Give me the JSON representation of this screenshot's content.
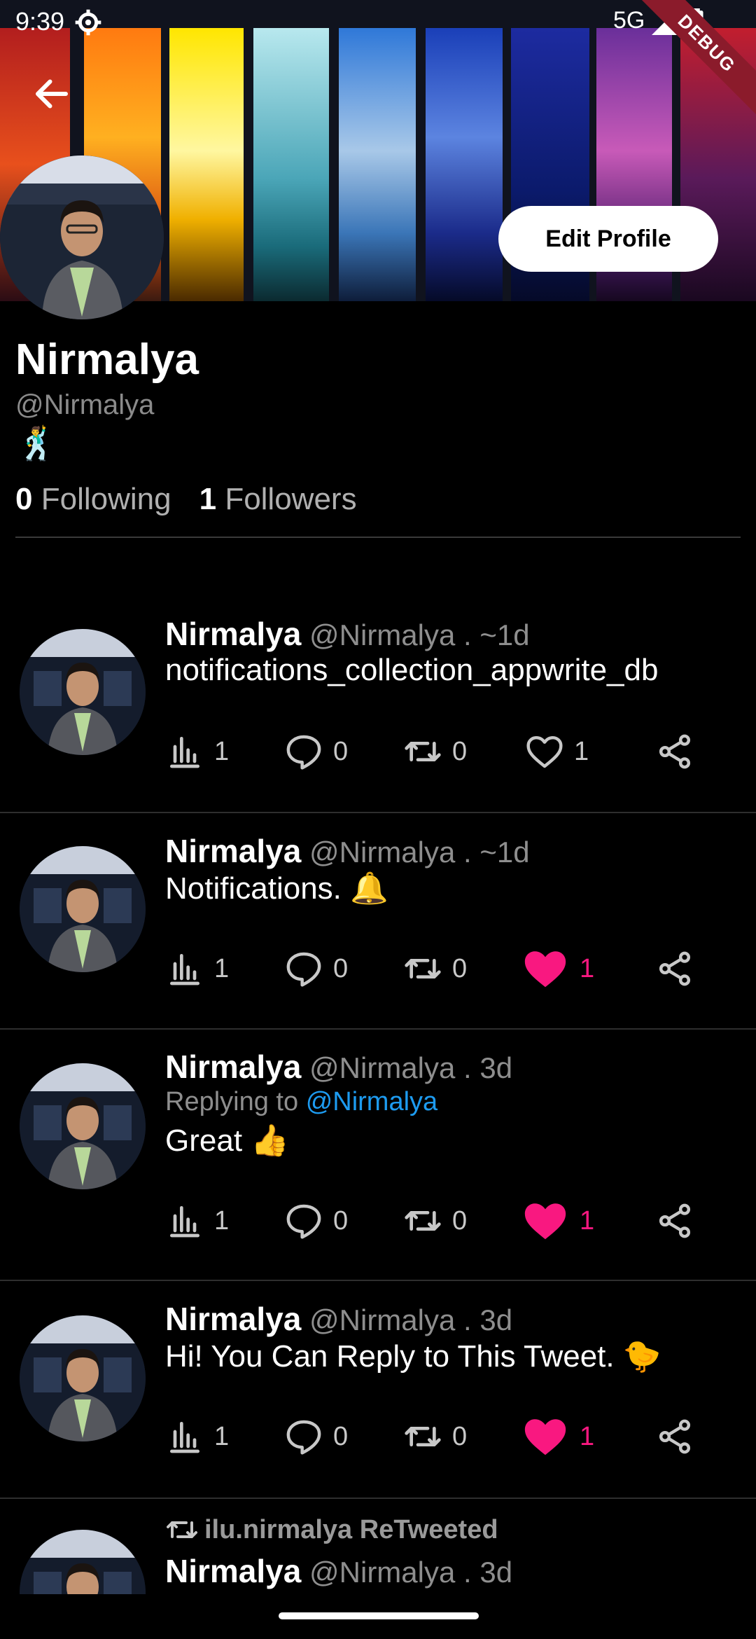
{
  "status": {
    "time": "9:39",
    "network": "5G",
    "debug_label": "DEBUG"
  },
  "profile": {
    "edit_button": "Edit Profile",
    "name": "Nirmalya",
    "handle": "@Nirmalya",
    "bio_emoji": "🕺",
    "following_count": "0",
    "following_label": "Following",
    "followers_count": "1",
    "followers_label": "Followers"
  },
  "tweets": [
    {
      "name": "Nirmalya",
      "meta": "@Nirmalya . ~1d",
      "text": "notifications_collection_appwrite_db",
      "views": "1",
      "comments": "0",
      "retweets": "0",
      "likes": "1",
      "liked": false
    },
    {
      "name": "Nirmalya",
      "meta": "@Nirmalya . ~1d",
      "text": "Notifications. 🔔",
      "views": "1",
      "comments": "0",
      "retweets": "0",
      "likes": "1",
      "liked": true
    },
    {
      "name": "Nirmalya",
      "meta": "@Nirmalya . 3d",
      "reply_prefix": "Replying to",
      "reply_to": "@Nirmalya",
      "text": "Great 👍",
      "views": "1",
      "comments": "0",
      "retweets": "0",
      "likes": "1",
      "liked": true
    },
    {
      "name": "Nirmalya",
      "meta": "@Nirmalya . 3d",
      "text": "Hi! You Can Reply to This Tweet. 🐤",
      "views": "1",
      "comments": "0",
      "retweets": "0",
      "likes": "1",
      "liked": true
    },
    {
      "retweet_label": "ilu.nirmalya ReTweeted",
      "name": "Nirmalya",
      "meta": "@Nirmalya . 3d"
    }
  ],
  "colors": {
    "accent_blue": "#1d9bf0",
    "like_pink": "#f91880",
    "background": "#000000"
  }
}
